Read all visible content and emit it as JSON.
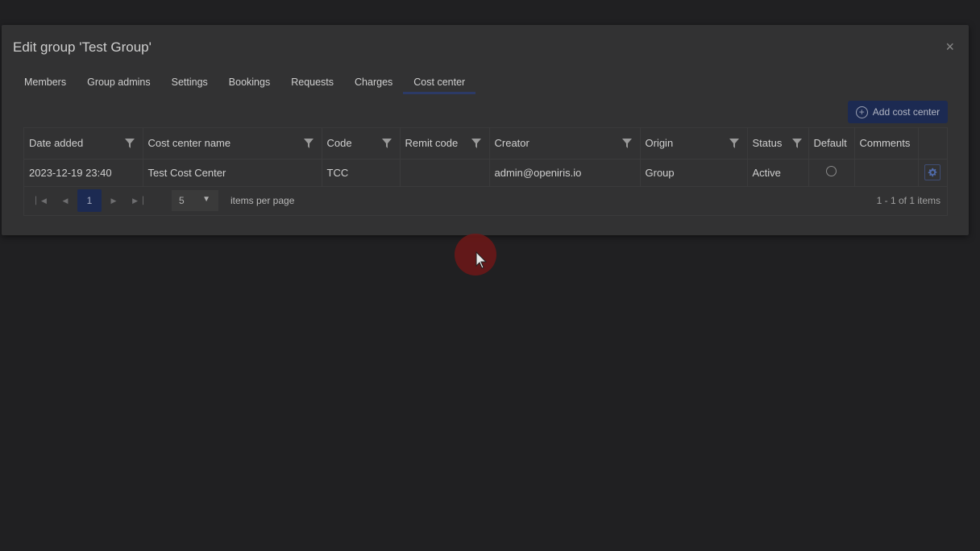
{
  "dialog": {
    "title": "Edit group 'Test Group'",
    "close_icon": "×"
  },
  "tabs": [
    {
      "label": "Members"
    },
    {
      "label": "Group admins"
    },
    {
      "label": "Settings"
    },
    {
      "label": "Bookings"
    },
    {
      "label": "Requests"
    },
    {
      "label": "Charges"
    },
    {
      "label": "Cost center",
      "active": true
    }
  ],
  "toolbar": {
    "add_label": "Add cost center",
    "add_icon": "plus-circle-icon"
  },
  "table": {
    "columns": [
      "Date added",
      "Cost center name",
      "Code",
      "Remit code",
      "Creator",
      "Origin",
      "Status",
      "Default",
      "Comments",
      ""
    ],
    "rows": [
      {
        "date_added": "2023-12-19 23:40",
        "name": "Test Cost Center",
        "code": "TCC",
        "remit_code": "",
        "creator": "admin@openiris.io",
        "origin": "Group",
        "status": "Active",
        "comments": ""
      }
    ]
  },
  "pager": {
    "current_page": "1",
    "page_size": "5",
    "per_page_label": "items per page",
    "info": "1 - 1 of 1 items"
  },
  "colors": {
    "accent": "#1c2a52",
    "overlay_bg": "#202022",
    "dialog_bg": "#323233"
  }
}
